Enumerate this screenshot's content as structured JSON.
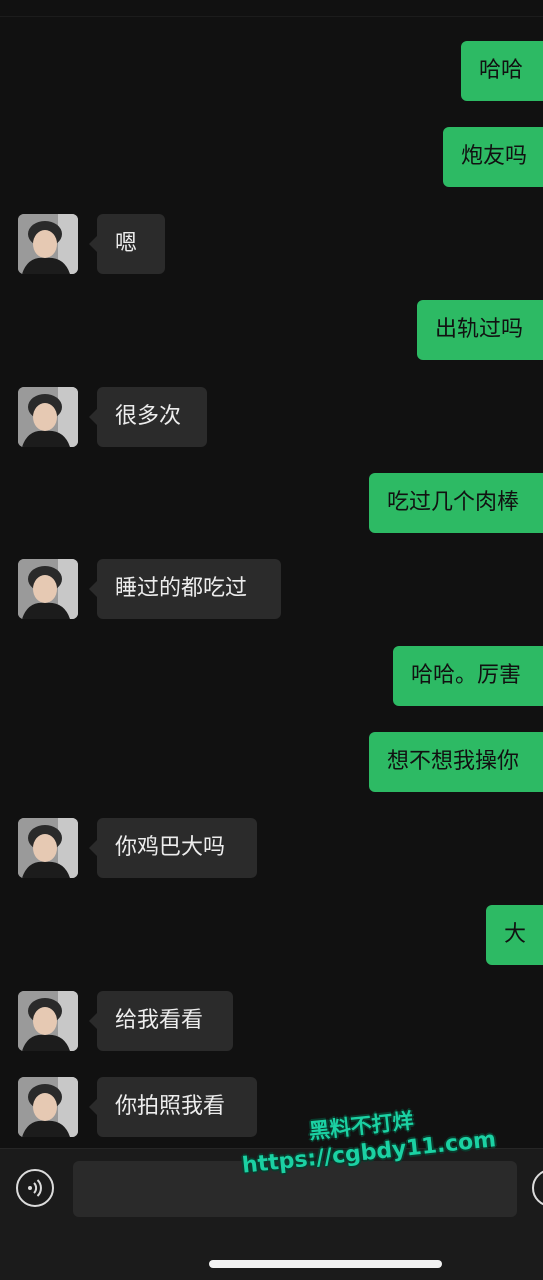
{
  "chat": {
    "messages": [
      {
        "from": "me",
        "text": "哈哈"
      },
      {
        "from": "me",
        "text": "炮友吗"
      },
      {
        "from": "other",
        "text": "嗯"
      },
      {
        "from": "me",
        "text": "出轨过吗"
      },
      {
        "from": "other",
        "text": "很多次"
      },
      {
        "from": "me",
        "text": "吃过几个肉棒"
      },
      {
        "from": "other",
        "text": "睡过的都吃过"
      },
      {
        "from": "me",
        "text": "哈哈。厉害"
      },
      {
        "from": "me",
        "text": "想不想我操你"
      },
      {
        "from": "other",
        "text": "你鸡巴大吗"
      },
      {
        "from": "me",
        "text": "大"
      },
      {
        "from": "other",
        "text": "给我看看"
      },
      {
        "from": "other",
        "text": "你拍照我看"
      }
    ]
  },
  "input_bar": {
    "voice_icon": "voice-icon",
    "emoji_icon": "emoji-icon",
    "message_value": ""
  },
  "watermark": {
    "line1": "黑料不打烊",
    "line2": "https://cgbdy11.com"
  },
  "colors": {
    "background": "#111111",
    "sent_bubble": "#2dba64",
    "received_bubble": "#2b2b2b",
    "watermark": "#1bd1a3"
  }
}
